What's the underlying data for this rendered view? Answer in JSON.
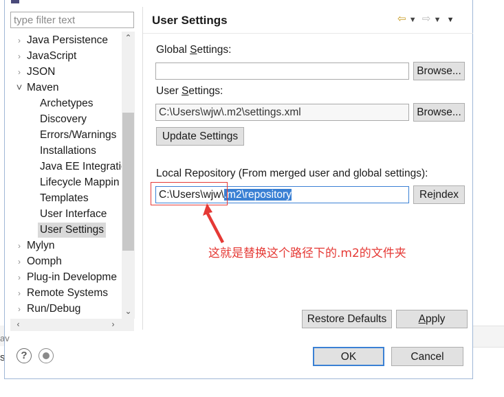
{
  "filter": {
    "placeholder": "type filter text"
  },
  "tree": {
    "items": [
      {
        "label": "Java Persistence",
        "expandable": true
      },
      {
        "label": "JavaScript",
        "expandable": true
      },
      {
        "label": "JSON",
        "expandable": true
      },
      {
        "label": "Maven",
        "expanded": true
      },
      {
        "label": "Archetypes"
      },
      {
        "label": "Discovery"
      },
      {
        "label": "Errors/Warnings"
      },
      {
        "label": "Installations"
      },
      {
        "label": "Java EE Integratio"
      },
      {
        "label": "Lifecycle Mappin"
      },
      {
        "label": "Templates"
      },
      {
        "label": "User Interface"
      },
      {
        "label": "User Settings",
        "selected": true
      },
      {
        "label": "Mylyn",
        "expandable": true
      },
      {
        "label": "Oomph",
        "expandable": true
      },
      {
        "label": "Plug-in Developme",
        "expandable": true
      },
      {
        "label": "Remote Systems",
        "expandable": true
      },
      {
        "label": "Run/Debug",
        "expandable": true
      }
    ]
  },
  "page": {
    "title": "User Settings",
    "global_settings_label_pre": "Global ",
    "global_settings_label_u": "S",
    "global_settings_label_post": "ettings:",
    "global_settings_value": "",
    "browse_label": "Browse...",
    "user_settings_label_pre": "User ",
    "user_settings_label_u": "S",
    "user_settings_label_post": "ettings:",
    "user_settings_value": "C:\\Users\\wjw\\.m2\\settings.xml",
    "update_settings_label": "Update Settings",
    "local_repo_label": "Local Repository (From merged user and global settings):",
    "local_repo_value_plain": "C:\\Users\\wjw\\",
    "local_repo_value_selected": ".m2\\repository",
    "reindex_pre": "Re",
    "reindex_u": "i",
    "reindex_post": "ndex",
    "restore_defaults_label": "Restore Defaults",
    "apply_pre": "",
    "apply_u": "A",
    "apply_post": "pply"
  },
  "annotation": {
    "text": "这就是替换这个路径下的.m2的文件夹",
    "color": "#e53935"
  },
  "dialog": {
    "ok_label": "OK",
    "cancel_label": "Cancel"
  },
  "edge": {
    "text1": "av",
    "text2": "s"
  },
  "colors": {
    "accent": "#3a80d4",
    "annotation": "#e53935",
    "selection": "#d9d9d9"
  }
}
